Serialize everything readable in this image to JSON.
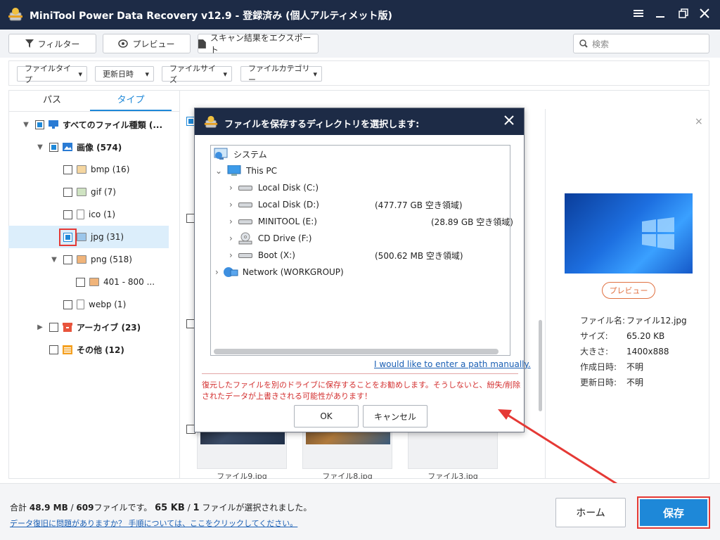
{
  "app": {
    "title": "MiniTool Power Data Recovery v12.9 - 登録済み (個人アルティメット版)"
  },
  "toolbar": {
    "filter": "フィルター",
    "preview": "プレビュー",
    "export": "スキャン結果をエクスポート",
    "search_placeholder": "検索"
  },
  "filters": [
    "ファイルタイプ",
    "更新日時",
    "ファイルサイズ",
    "ファイルカテゴリー"
  ],
  "tabs": {
    "path": "パス",
    "type": "タイプ"
  },
  "tree": {
    "root": "すべてのファイル種類 (...",
    "images": "画像 (574)",
    "bmp": "bmp (16)",
    "gif": "gif (7)",
    "ico": "ico (1)",
    "jpg": "jpg (31)",
    "png": "png (518)",
    "png_sub": "401 - 800 ...",
    "webp": "webp (1)",
    "archive": "アーカイブ (23)",
    "other": "その他 (12)"
  },
  "thumbs": [
    "ファイル9.jpg",
    "ファイル8.jpg",
    "ファイル3.jpg"
  ],
  "preview": {
    "button": "プレビュー",
    "rows": [
      {
        "label": "ファイル名:",
        "value": "ファイル12.jpg"
      },
      {
        "label": "サイズ:",
        "value": "65.20 KB"
      },
      {
        "label": "大きさ:",
        "value": "1400x888"
      },
      {
        "label": "作成日時:",
        "value": "不明"
      },
      {
        "label": "更新日時:",
        "value": "不明"
      }
    ]
  },
  "dialog": {
    "title": "ファイルを保存するディレクトリを選択します:",
    "system": "システム",
    "thispc": "This PC",
    "drives": [
      {
        "name": "Local Disk (C:)",
        "free": ""
      },
      {
        "name": "Local Disk (D:)",
        "free": "(477.77 GB 空き領域)"
      },
      {
        "name": "MINITOOL (E:)",
        "free": "(28.89 GB 空き領域)"
      },
      {
        "name": "CD Drive (F:)",
        "free": ""
      },
      {
        "name": "Boot (X:)",
        "free": "(500.62 MB 空き領域)"
      }
    ],
    "network": "Network (WORKGROUP)",
    "manual_link": "I would like to enter a path manually.",
    "warning": "復元したファイルを別のドライブに保存することをお勧めします。そうしないと、紛失/削除されたデータが上書きされる可能性があります！",
    "ok": "OK",
    "cancel": "キャンセル"
  },
  "footer": {
    "total_prefix": "合計",
    "total_size": "48.9 MB",
    "slash": "/",
    "total_files": "609",
    "files_suffix": "ファイルです。",
    "sel_size": "65 KB",
    "sel_count": "1",
    "sel_suffix": "ファイルが選択されました。",
    "help_link": "データ復旧に問題がありますか？ 手順については、ここをクリックしてください。",
    "home": "ホーム",
    "save": "保存"
  },
  "colors": {
    "titlebar": "#1d2b46",
    "accent": "#1e88d8",
    "highlight": "#e53935",
    "warning": "#d32f2f",
    "link": "#1a5fb4"
  }
}
